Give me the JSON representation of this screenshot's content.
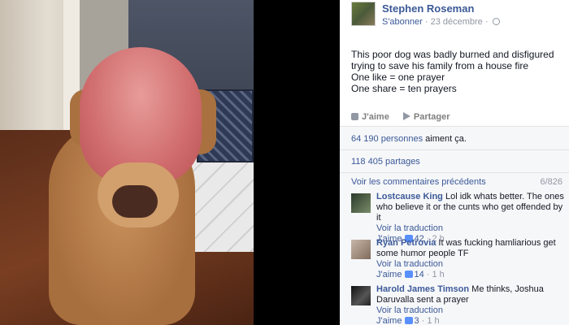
{
  "post": {
    "author": "Stephen Roseman",
    "subscribe": "S'abonner",
    "date": "· 23 décembre ·",
    "text_lines": [
      "This poor dog was badly burned and disfigured",
      "trying to save his family from a house fire",
      "One like = one prayer",
      "One share = ten prayers"
    ],
    "actions": {
      "like": "J'aime",
      "share": "Partager"
    }
  },
  "ufi": {
    "likes_count": "64 190 personnes",
    "likes_suffix": " aiment ça.",
    "shares": "118 405 partages",
    "view_previous": "Voir les commentaires précédents",
    "count": "6/826"
  },
  "comments": [
    {
      "name": "Lostcause King",
      "text": " Lol idk whats better. The ones who believe it or the cunts who get offended by it",
      "translate": "Voir la traduction",
      "like_label": "J'aime",
      "likes": "42",
      "time": "· 2 h"
    },
    {
      "name": "Ryan Petrovia",
      "text": " It was fucking hamliarious get some humor people TF",
      "translate": "Voir la traduction",
      "like_label": "J'aime",
      "likes": "14",
      "time": "· 1 h"
    },
    {
      "name": "Harold James Timson",
      "text": " Me thinks, Joshua Daruvalla sent a prayer",
      "translate": "Voir la traduction",
      "like_label": "J'aime",
      "likes": "3",
      "time": "· 1 h"
    }
  ]
}
